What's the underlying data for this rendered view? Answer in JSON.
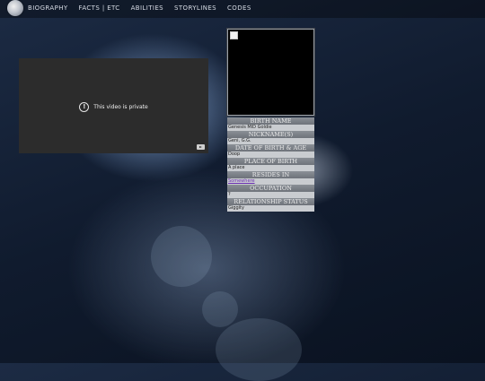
{
  "nav": {
    "items": [
      "BIOGRAPHY",
      "FACTS | ETC",
      "ABILITIES",
      "STORYLINES",
      "CODES"
    ]
  },
  "video": {
    "message": "This video is private"
  },
  "profile": {
    "fields": [
      {
        "label": "BIRTH NAME",
        "value": "Genesis MID Goldie"
      },
      {
        "label": "NICKNAME(S)",
        "value": "Geni, G.G."
      },
      {
        "label": "DATE OF BIRTH & AGE",
        "value": "Doop"
      },
      {
        "label": "PLACE OF BIRTH",
        "value": "A place"
      },
      {
        "label": "RESIDES IN",
        "value": "Somewhere"
      },
      {
        "label": "OCCUPATION",
        "value": "?"
      },
      {
        "label": "RELATIONSHIP STATUS",
        "value": "Giggity"
      }
    ]
  }
}
